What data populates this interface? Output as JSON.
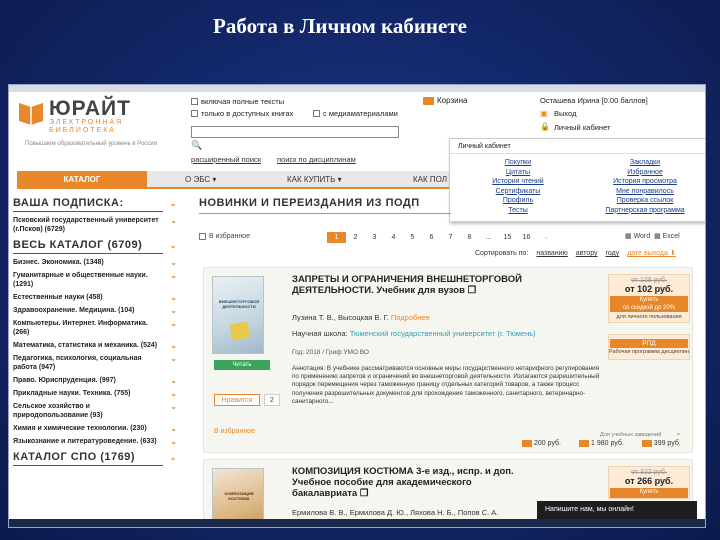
{
  "slide_title": "Работа в Личном кабинете",
  "logo": {
    "name": "ЮРАЙТ",
    "sub1": "ЭЛЕКТРОННАЯ",
    "sub2": "БИБЛИОТЕКА",
    "slogan": "Повышаем образовательный уровень в России"
  },
  "search": {
    "opt_full_text": "включая полные тексты",
    "opt_available": "только в доступных книгах",
    "opt_multimedia": "с медиаматериалами",
    "value": "",
    "advanced": "расширенный поиск",
    "by_discipline": "поиск по дисциплинам"
  },
  "header": {
    "cart": "Корзина",
    "user": "Осташева Ирина [0.00 баллов]",
    "logout": "Выход",
    "cabinet": "Личный кабинет"
  },
  "nav": {
    "catalog": "КАТАЛОГ",
    "ebs": "О ЭБС ▾",
    "how_buy": "КАК КУПИТЬ ▾",
    "kak_pol": "КАК ПОЛ"
  },
  "cabinet_menu": {
    "title": "Личный кабинет",
    "left": [
      "Покупки",
      "Цитаты",
      "История чтений",
      "Сертификаты",
      "Профиль",
      "Тесты"
    ],
    "right": [
      "Закладки",
      "Избранное",
      "История просмотра",
      "Мне понравилось",
      "Проверка ссылок",
      "Партнерская программа"
    ]
  },
  "sidebar": {
    "subscription_h": "ВАША ПОДПИСКА:",
    "subscription_item": "Псковский государственный университет (г.Псков) (6729)",
    "catalog_h": "ВЕСЬ КАТАЛОГ (6709)",
    "items": [
      "Бизнес. Экономика. (1348)",
      "Гуманитарные и общественные науки. (1291)",
      "Естественные науки (458)",
      "Здравоохранение. Медицина. (104)",
      "Компьютеры. Интернет. Информатика. (266)",
      "Математика, статистика и механика. (524)",
      "Педагогика, психология, социальная работа (947)",
      "Право. Юриспруденция. (997)",
      "Прикладные науки. Техника. (755)",
      "Сельское хозяйство и природопользование (93)",
      "Химия и химические технологии. (230)",
      "Языкознание и литературоведение. (633)"
    ],
    "spo_h": "КАТАЛОГ СПО (1769)"
  },
  "main": {
    "heading": "НОВИНКИ И ПЕРЕИЗДАНИЯ ИЗ ПОДП",
    "to_favorites": "В избранное",
    "pages": [
      "1",
      "2",
      "3",
      "4",
      "5",
      "6",
      "7",
      "8",
      "...",
      "15",
      "16",
      "→"
    ],
    "word": "Word",
    "excel": "Excel",
    "sort_label": "Сортировать по:",
    "sort_options": [
      "названию",
      "автору",
      "году",
      "дате выхода ⬇"
    ]
  },
  "books": [
    {
      "title": "ЗАПРЕТЫ И ОГРАНИЧЕНИЯ ВНЕШНЕТОРГОВОЙ ДЕЯТЕЛЬНОСТИ. Учебник для вузов",
      "cover_text": "ВНЕШНЕТОРГОВОЙ ДЕЯТЕЛЬНОСТИ",
      "authors": "Лузина Т. В., Высоцкая В. Г.",
      "more": "Подробнее",
      "school_label": "Научная школа:",
      "school": "Тюменский государственный университет (г. Тюмень)",
      "meta": "Год: 2018 / Гриф УМО ВО",
      "annotation": "Аннотация: В учебнике рассматриваются основные меры государственного нетарифного регулирования по применению запретов и ограничений во внешнеторговой деятельности. Излагаются разрешительный порядок перемещения через таможенную границу отдельных категорий товаров, а также процесс получения разрешительных документов для прохождения таможенного, санитарного, ветеринарно-санитарного...",
      "read": "Читать",
      "like": "Нравится",
      "like_count": "2",
      "favorite": "В избранное",
      "old_price": "от 128 руб.",
      "new_price": "от 102 руб.",
      "buy": "Купить",
      "buy_discount": "со скидкой до 20%",
      "buy_note": "для личного пользования",
      "rpd": "РПД",
      "rpd_note": "Рабочая программа дисциплин",
      "edu_label": "Для учебных заведений",
      "prices": [
        "200 руб.",
        "1 980 руб.",
        "399 руб."
      ]
    },
    {
      "title": "КОМПОЗИЦИЯ КОСТЮМА 3-е изд., испр. и доп. Учебное пособие для академического бакалавриата",
      "cover_text": "КОМПОЗИЦИЯ КОСТЮМА",
      "authors": "Ермилова В. В., Ермилова Д. Ю., Ляхова Н. Б., Попов С. А.",
      "old_price": "от 332 руб.",
      "new_price": "от 266 руб.",
      "buy": "Купить"
    }
  ],
  "chat": "Напишите нам, мы онлайн!",
  "colors": {
    "accent": "#e8872a",
    "read_green": "#3aa55a",
    "school_teal": "#2f9fb5",
    "slide_bg": "#142a6e"
  }
}
